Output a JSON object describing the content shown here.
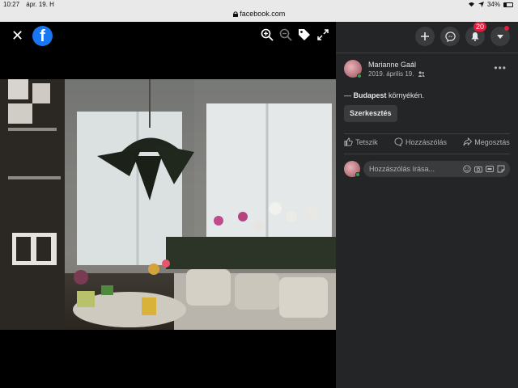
{
  "status_bar": {
    "time": "10:27",
    "date": "ápr. 19. H",
    "battery": "34%"
  },
  "browser": {
    "url": "facebook.com"
  },
  "viewer": {
    "close_glyph": "✕",
    "logo_letter": "f"
  },
  "header_icons": {
    "notifications_count": "20"
  },
  "post": {
    "author": "Marianne Gaál",
    "date": "2019. április 19.",
    "more_glyph": "•••",
    "location_prefix": "— ",
    "location_city": "Budapest",
    "location_suffix": " környékén.",
    "edit_label": "Szerkesztés"
  },
  "actions": {
    "like": "Tetszik",
    "comment": "Hozzászólás",
    "share": "Megosztás"
  },
  "comment": {
    "placeholder": "Hozzászólás írása..."
  },
  "colors": {
    "facebook_blue": "#1877f2",
    "panel_bg": "#242526",
    "badge_red": "#e41e3f"
  }
}
